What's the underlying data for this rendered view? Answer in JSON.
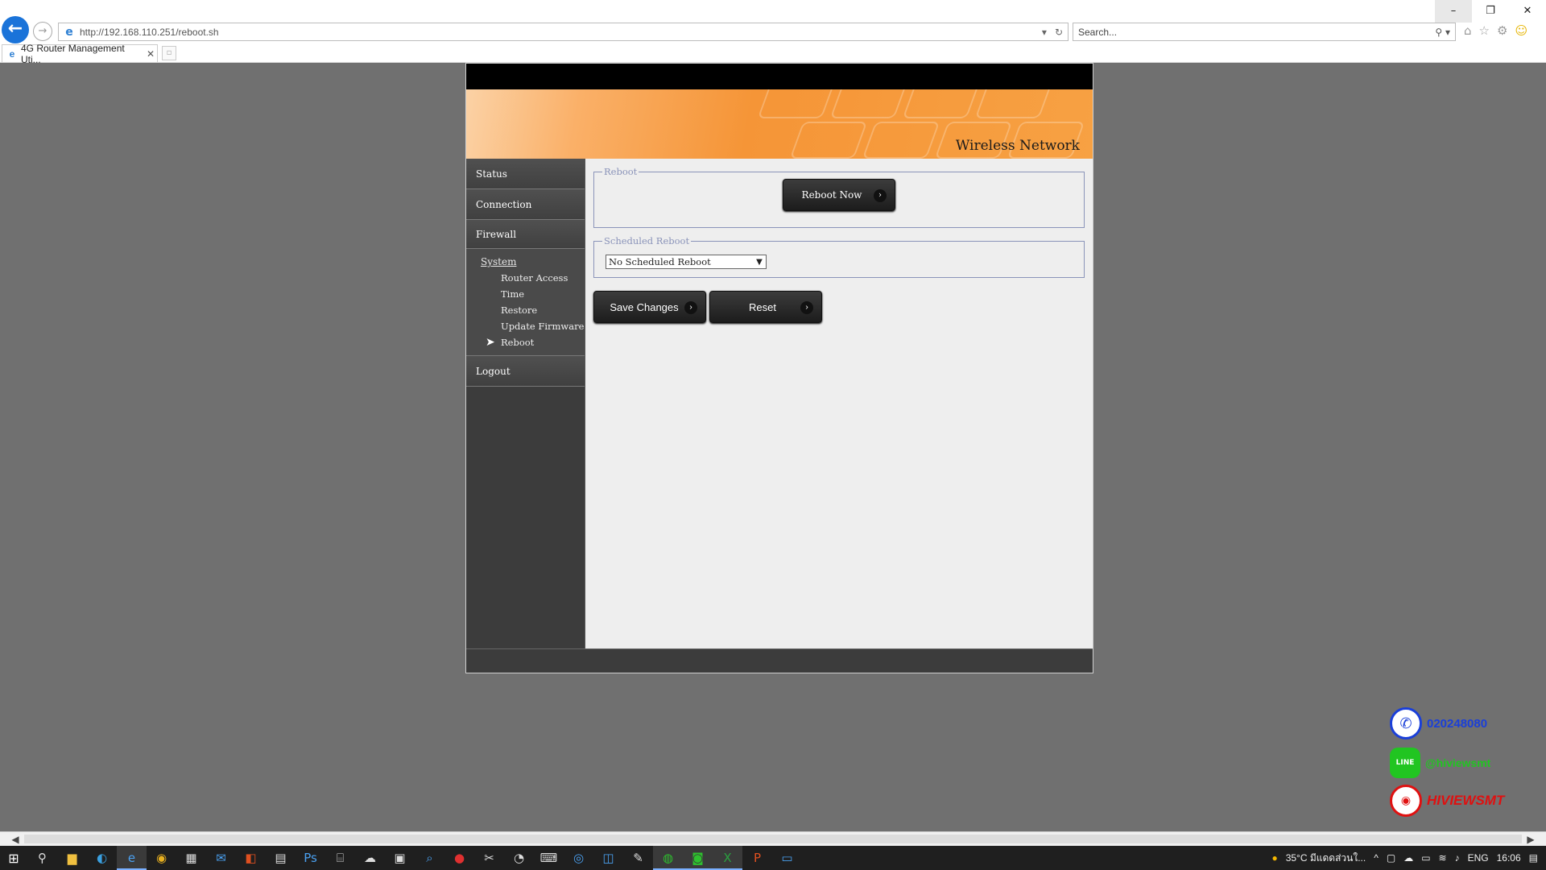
{
  "browser": {
    "url": "http://192.168.110.251/reboot.sh",
    "search_placeholder": "Search...",
    "tab_title": "4G Router Management Uti...",
    "window_controls": [
      "–",
      "❐",
      "✕"
    ]
  },
  "router": {
    "banner_title": "Wireless Network",
    "sidebar": {
      "status": "Status",
      "connection": "Connection",
      "firewall": "Firewall",
      "system": "System",
      "router_access": "Router Access",
      "time": "Time",
      "restore": "Restore",
      "update_firmware": "Update Firmware",
      "reboot": "Reboot",
      "logout": "Logout"
    },
    "reboot_section": {
      "legend": "Reboot",
      "button": "Reboot Now"
    },
    "scheduled_section": {
      "legend": "Scheduled Reboot",
      "selected": "No Scheduled Reboot"
    },
    "save_button": "Save Changes",
    "reset_button": "Reset"
  },
  "watermark": "HIVIEWSMT",
  "contacts": {
    "phone": "020248080",
    "line": "@hiviewsmt",
    "brand": "HIVIEWSMT"
  },
  "taskbar": {
    "weather": "35°C  มีแดดส่วนใ...",
    "language": "ENG",
    "time": "16:06"
  },
  "colors": {
    "banner_orange": "#f59537",
    "sidebar_dark": "#3c3c3c",
    "fieldset_border": "#8a93b9"
  }
}
